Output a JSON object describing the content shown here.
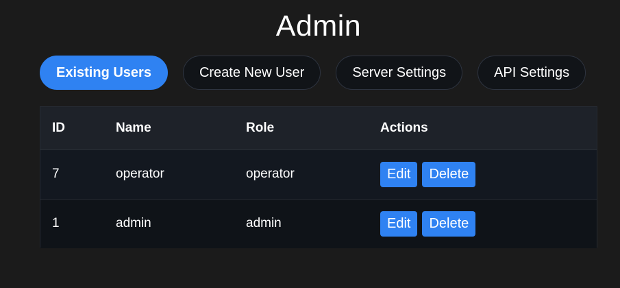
{
  "page": {
    "title": "Admin"
  },
  "tabs": [
    {
      "label": "Existing Users",
      "active": true
    },
    {
      "label": "Create New User",
      "active": false
    },
    {
      "label": "Server Settings",
      "active": false
    },
    {
      "label": "API Settings",
      "active": false
    }
  ],
  "users_table": {
    "headers": {
      "id": "ID",
      "name": "Name",
      "role": "Role",
      "actions": "Actions"
    },
    "rows": [
      {
        "id": "7",
        "name": "operator",
        "role": "operator",
        "edit_label": "Edit",
        "delete_label": "Delete"
      },
      {
        "id": "1",
        "name": "admin",
        "role": "admin",
        "edit_label": "Edit",
        "delete_label": "Delete"
      }
    ]
  },
  "colors": {
    "background": "#1b1b1b",
    "accent": "#2f82f2",
    "tab_inactive": "#111418",
    "table_header": "#1e2229"
  }
}
